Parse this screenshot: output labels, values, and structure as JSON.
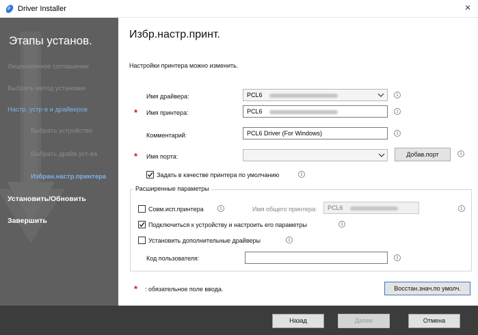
{
  "window": {
    "title": "Driver Installer",
    "close_glyph": "×"
  },
  "sidebar": {
    "heading": "Этапы установ.",
    "steps": [
      {
        "label": "Лицензионное соглашение",
        "state": "done"
      },
      {
        "label": "Выбрать метод установки",
        "state": "done"
      },
      {
        "label": "Настр. устр-в и драйверов",
        "state": "active"
      },
      {
        "label": "Выбрать устройство",
        "state": "done-sub"
      },
      {
        "label": "Выбрать драйв.уст-ва",
        "state": "done-sub"
      },
      {
        "label": "Избран.настр.принтера",
        "state": "current"
      },
      {
        "label": "Установить/Обновить",
        "state": "pending"
      },
      {
        "label": "Завершить",
        "state": "pending"
      }
    ]
  },
  "main": {
    "title": "Избр.настр.принт.",
    "subtitle": "Настройки принтера можно изменить.",
    "driver_name": {
      "label": "Имя драйвера:",
      "value": "PCL6"
    },
    "printer_name": {
      "label": "Имя принтера:",
      "value": "PCL6"
    },
    "comment": {
      "label": "Комментарий:",
      "value": "PCL6 Driver (For Windows)"
    },
    "port_name": {
      "label": "Имя порта:",
      "value": ""
    },
    "add_port_button": "Добав.порт",
    "default_printer": {
      "label": "Задать в качестве принтера по умолчанию",
      "checked": true
    },
    "advanced": {
      "title": "Расширенные параметры",
      "share": {
        "label": "Совм.исп.принтера",
        "checked": false
      },
      "share_name": {
        "label": "Имя общего принтера:",
        "value": "PCL6"
      },
      "connect": {
        "label": "Подключиться к устройству и настроить его параметры",
        "checked": true
      },
      "extra_drivers": {
        "label": "Установить дополнительные драйверы",
        "checked": false
      },
      "user_code": {
        "label": "Код пользователя:",
        "value": ""
      }
    },
    "required_marker": "*",
    "required_note": ": обязательное поле ввода.",
    "restore_button": "Восстан.знач.по умолч."
  },
  "footer": {
    "back": "Назад",
    "next": "Далее",
    "cancel": "Отмена"
  },
  "icons": {
    "info": "i",
    "chevron": "chevron-down-icon",
    "app": "driver-installer-icon"
  },
  "colors": {
    "sidebar_bg": "#5f5f5f",
    "footer_bg": "#3c3c3c",
    "accent": "#7fb2e8",
    "required": "#d01a1a"
  }
}
